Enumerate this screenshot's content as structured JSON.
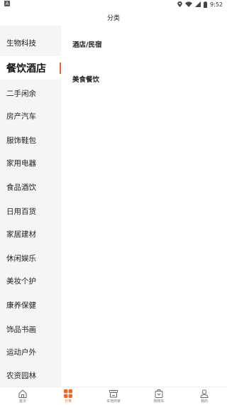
{
  "status_bar": {
    "app_badge": "A",
    "time": "9:52"
  },
  "header": {
    "title": "分类"
  },
  "sidebar": {
    "items": [
      {
        "label": "生物科技",
        "active": false
      },
      {
        "label": "餐饮酒店",
        "active": true
      },
      {
        "label": "二手闲余",
        "active": false
      },
      {
        "label": "房产汽车",
        "active": false
      },
      {
        "label": "服饰鞋包",
        "active": false
      },
      {
        "label": "家用电器",
        "active": false
      },
      {
        "label": "食品酒饮",
        "active": false
      },
      {
        "label": "日用百货",
        "active": false
      },
      {
        "label": "家居建材",
        "active": false
      },
      {
        "label": "休闲娱乐",
        "active": false
      },
      {
        "label": "美妆个护",
        "active": false
      },
      {
        "label": "康养保健",
        "active": false
      },
      {
        "label": "饰品书画",
        "active": false
      },
      {
        "label": "运动户外",
        "active": false
      },
      {
        "label": "农资园林",
        "active": false
      }
    ]
  },
  "content": {
    "sections": [
      {
        "title": "酒店/民宿"
      },
      {
        "title": "美食餐饮"
      }
    ]
  },
  "tab_bar": {
    "tabs": [
      {
        "label": "首页",
        "icon": "home-icon",
        "active": false
      },
      {
        "label": "分类",
        "icon": "grid-icon",
        "active": true
      },
      {
        "label": "本地商家",
        "icon": "store-icon",
        "active": false
      },
      {
        "label": "购物车",
        "icon": "cart-icon",
        "active": false
      },
      {
        "label": "我的",
        "icon": "user-icon",
        "active": false
      }
    ]
  },
  "colors": {
    "accent": "#e8692c",
    "sidebar_bg": "#f5f5f5"
  }
}
